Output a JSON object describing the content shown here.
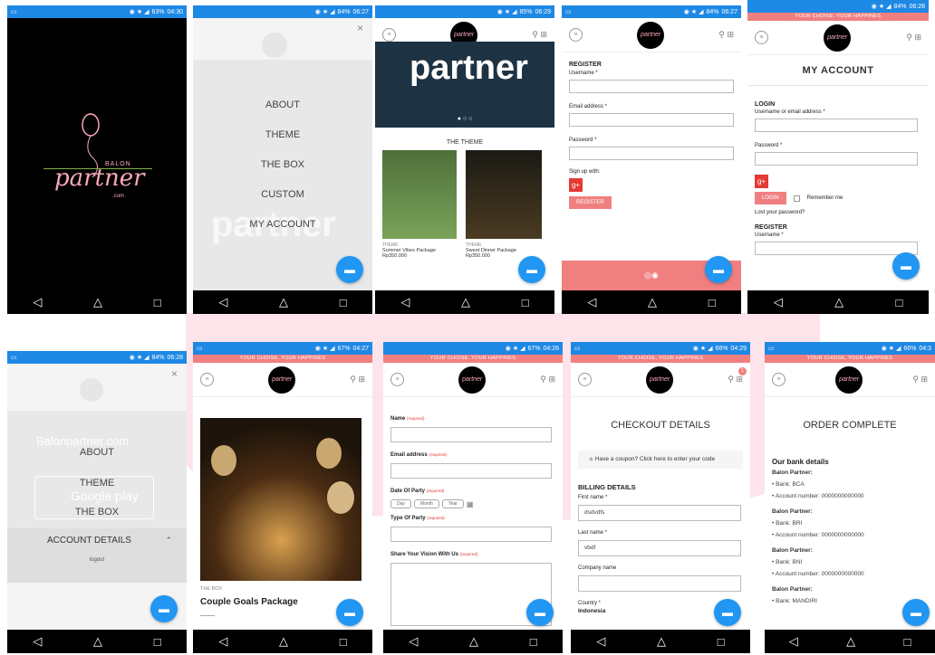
{
  "status": {
    "p1": {
      "time": "04:30",
      "battery": "63%"
    },
    "p2": {
      "time": "06:27",
      "battery": "84%"
    },
    "p3": {
      "time": "06:29",
      "battery": "85%"
    },
    "p4": {
      "time": "06:27",
      "battery": "84%"
    },
    "p5": {
      "time": "06:28",
      "battery": "84%"
    },
    "p6": {
      "time": "06:28",
      "battery": "84%"
    },
    "p7": {
      "time": "04:27",
      "battery": "67%"
    },
    "p8": {
      "time": "04:26",
      "battery": "67%"
    },
    "p9": {
      "time": "04:29",
      "battery": "66%"
    },
    "p10": {
      "time": "04:3",
      "battery": "66%"
    }
  },
  "brand": {
    "tagline": "YOUR CHOISE, YOUR HAPPINES",
    "logo_small": "partner",
    "splash_top": "BALON",
    "splash_main": "partner",
    "splash_sub": ".com"
  },
  "menu": {
    "items": [
      "ABOUT",
      "THEME",
      "THE BOX",
      "CUSTOM",
      "MY ACCOUNT"
    ],
    "bg_word": "partner"
  },
  "theme_page": {
    "hero_word": "partner",
    "section_title": "THE THEME",
    "products": [
      {
        "category": "THEME",
        "name": "Summer Vibes Package",
        "price": "Rp350.000"
      },
      {
        "category": "THEME",
        "name": "Sweet Dinner Package",
        "price": "Rp350.000"
      }
    ]
  },
  "register": {
    "title": "REGISTER",
    "username_label": "Username *",
    "email_label": "Email address *",
    "password_label": "Password *",
    "signup_with": "Sign up with:",
    "gplus": "g+",
    "button": "REGISTER"
  },
  "my_account": {
    "title": "MY ACCOUNT",
    "login_title": "LOGIN",
    "username_label": "Username or email address *",
    "password_label": "Password *",
    "login_button": "LOGIN",
    "remember": "Remember me",
    "lost_password": "Lost your password?",
    "register_title": "REGISTER",
    "register_username": "Username *"
  },
  "account_menu": {
    "bg_text": "Balonpartner.com",
    "about": "ABOUT",
    "theme": "THEME",
    "google_play": "Google play",
    "the_box": "THE BOX",
    "account_details": "ACCOUNT DETAILS",
    "logout": "logout"
  },
  "box_page": {
    "category": "THE BOX",
    "title": "Couple Goals Package"
  },
  "custom_form": {
    "name_label": "Name",
    "email_label": "Email address",
    "date_label": "Date Of Party",
    "day": "Day",
    "month": "Month",
    "year": "Year",
    "type_label": "Type Of Party",
    "vision_label": "Share Your Vision With Us",
    "required": "(required)"
  },
  "checkout": {
    "title": "CHECKOUT DETAILS",
    "coupon": "Have a coupon? Click here to enter your code",
    "billing_title": "BILLING DETAILS",
    "first_name_label": "First name *",
    "first_name_value": "dsdvdfs",
    "last_name_label": "Last name *",
    "last_name_value": "vbdf",
    "company_label": "Company name",
    "country_label": "Country *",
    "country_value": "Indonesia",
    "cart_count": "1"
  },
  "order_complete": {
    "title": "ORDER COMPLETE",
    "bank_title": "Our bank details",
    "account_name": "Balon Partner:",
    "banks": [
      {
        "bank": "Bank: BCA",
        "account": "Account number: 0000000000000"
      },
      {
        "bank": "Bank: BRI",
        "account": "Account number: 0000000000000"
      },
      {
        "bank": "Bank: BNI",
        "account": "Account number: 0000000000000"
      },
      {
        "bank": "Bank: MANDIRI",
        "account": ""
      }
    ]
  },
  "colors": {
    "accent": "#f08080",
    "status_bar": "#1e88e5",
    "fab": "#2196f3"
  }
}
